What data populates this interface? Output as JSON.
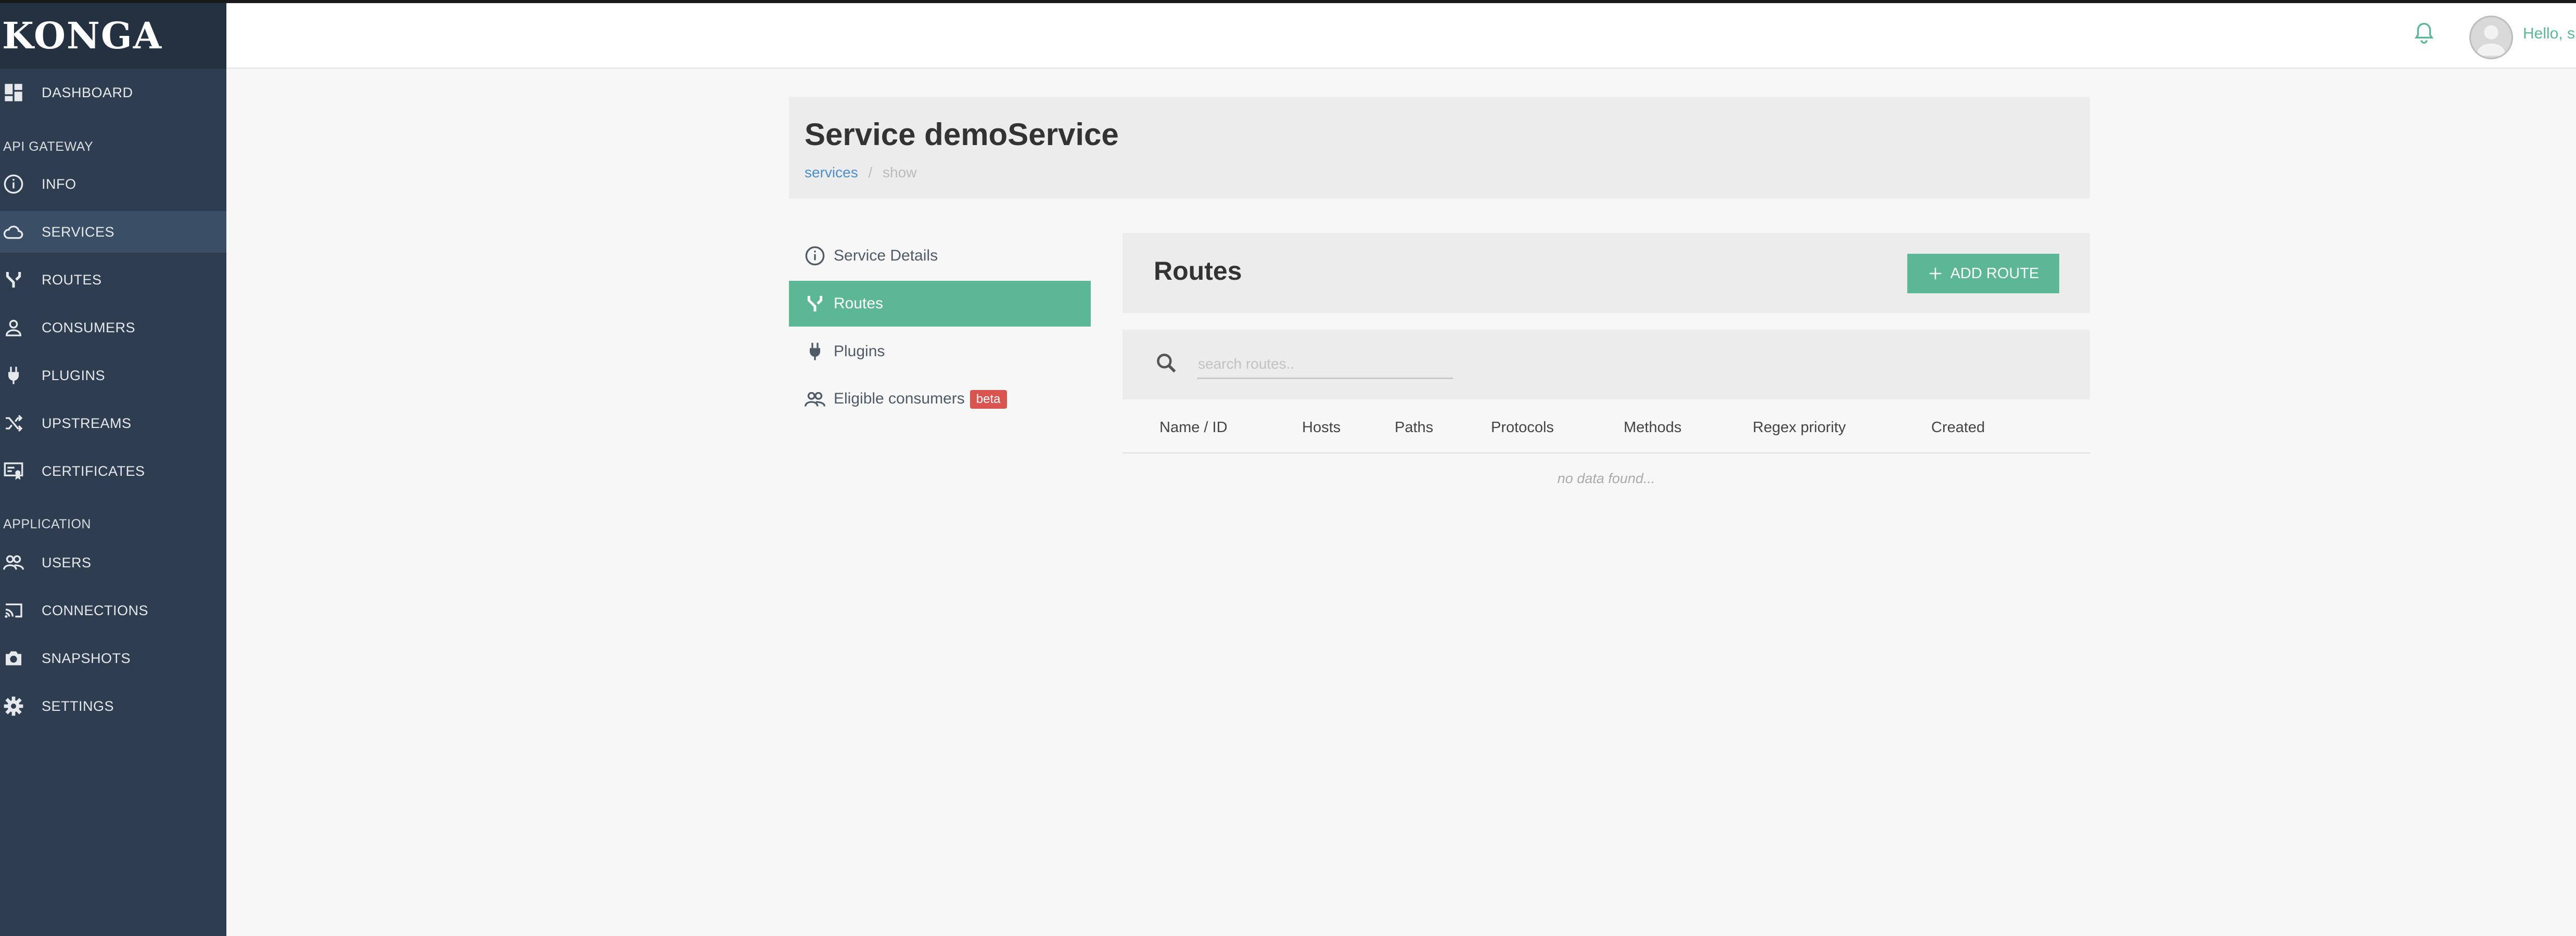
{
  "app": {
    "logo": "KONGA"
  },
  "sidebar": {
    "dashboard": "DASHBOARD",
    "section_api": "API GATEWAY",
    "api_items": [
      "INFO",
      "SERVICES",
      "ROUTES",
      "CONSUMERS",
      "PLUGINS",
      "UPSTREAMS",
      "CERTIFICATES"
    ],
    "section_app": "APPLICATION",
    "app_items": [
      "USERS",
      "CONNECTIONS",
      "SNAPSHOTS",
      "SETTINGS"
    ],
    "active": "SERVICES"
  },
  "topbar": {
    "greeting": "Hello, s"
  },
  "header": {
    "title": "Service demoService",
    "breadcrumb": {
      "link": "services",
      "separator": "/",
      "current": "show"
    }
  },
  "subnav": {
    "items": [
      "Service Details",
      "Routes",
      "Plugins",
      "Eligible consumers"
    ],
    "badge": "beta",
    "active": "Routes"
  },
  "routes": {
    "title": "Routes",
    "add_button": "ADD ROUTE",
    "search_placeholder": "search routes..",
    "columns": [
      "Name / ID",
      "Hosts",
      "Paths",
      "Protocols",
      "Methods",
      "Regex priority",
      "Created"
    ],
    "empty_text": "no data found..."
  },
  "colors": {
    "accent": "#5cb796",
    "sidebar": "#2e3e50",
    "badge": "#d9534f",
    "link": "#4a8fc8"
  }
}
